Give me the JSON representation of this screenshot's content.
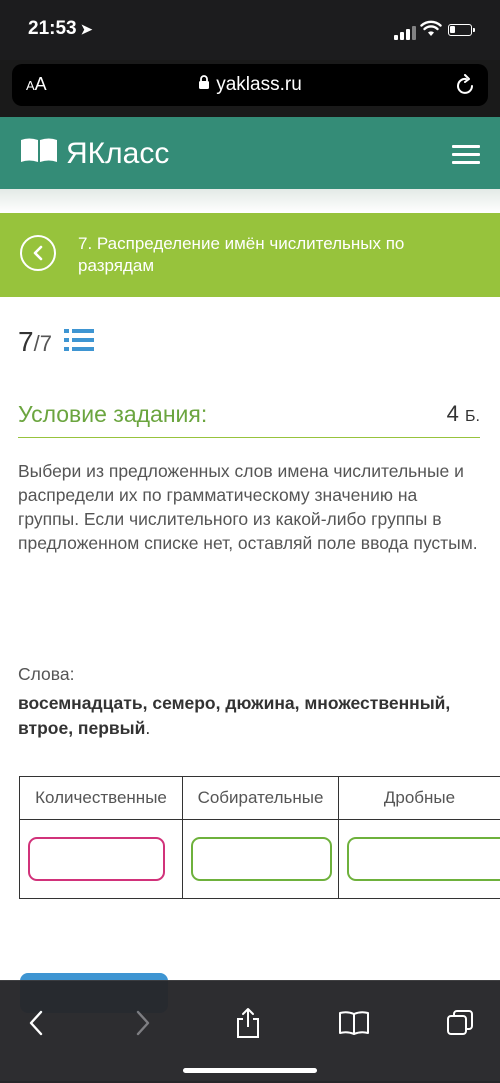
{
  "status": {
    "time": "21:53",
    "arrow": "➤"
  },
  "browser": {
    "aa_small": "A",
    "aa_large": "A",
    "domain": "yaklass.ru"
  },
  "header": {
    "logo_text": "ЯКласс"
  },
  "topic": {
    "title": "7. Распределение имён числительных по разрядам"
  },
  "progress": {
    "current": "7",
    "total": "/7"
  },
  "condition": {
    "title": "Условие задания:",
    "points": "4",
    "points_unit": "Б."
  },
  "task": {
    "text": "Выбери из предложенных слов имена числительные и распредели их по грамматическому значению на группы. Если числительного из какой-либо группы в предложенном списке нет, оставляй поле ввода пустым.",
    "words_label": "Слова:",
    "words": "восемнадцать, семеро, дюжина, множественный, втрое, первый",
    "words_end": "."
  },
  "table": {
    "headers": [
      "Количественные",
      "Собирательные",
      "Дробные"
    ]
  },
  "colors": {
    "header": "#348c77",
    "topic": "#97c33c",
    "accent_green": "#6ba53f",
    "input_pink": "#d1327a",
    "input_green": "#6eb13c"
  }
}
